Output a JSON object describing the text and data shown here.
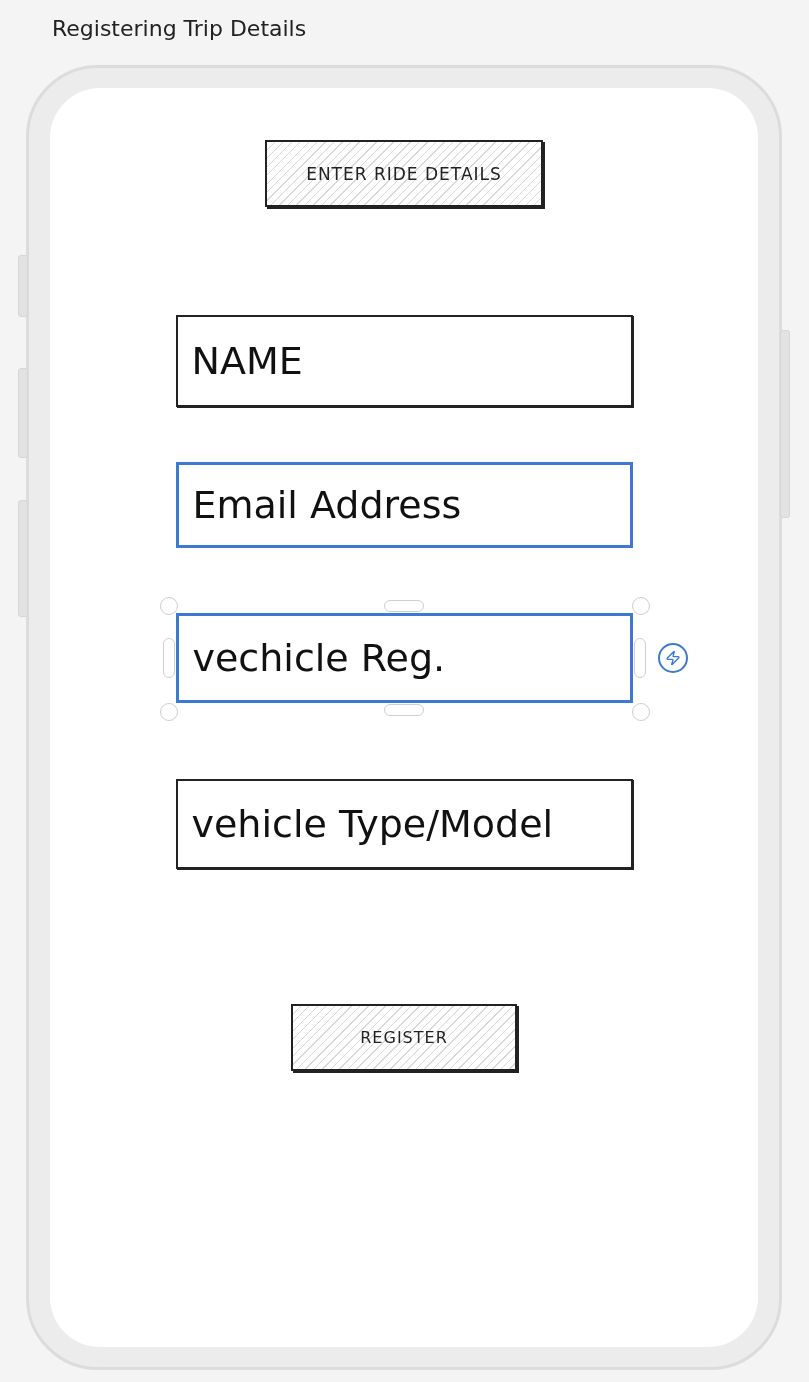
{
  "window": {
    "title": "Registering Trip Details"
  },
  "screen": {
    "heading": "ENTER RIDE DETAILS",
    "fields": [
      {
        "placeholder": "NAME",
        "hovered": false,
        "selected": false
      },
      {
        "placeholder": "Email Address",
        "hovered": true,
        "selected": false
      },
      {
        "placeholder": "vechicle Reg.",
        "hovered": false,
        "selected": true
      },
      {
        "placeholder": "vehicle Type/Model",
        "hovered": false,
        "selected": false
      }
    ],
    "button": "REGISTER"
  }
}
